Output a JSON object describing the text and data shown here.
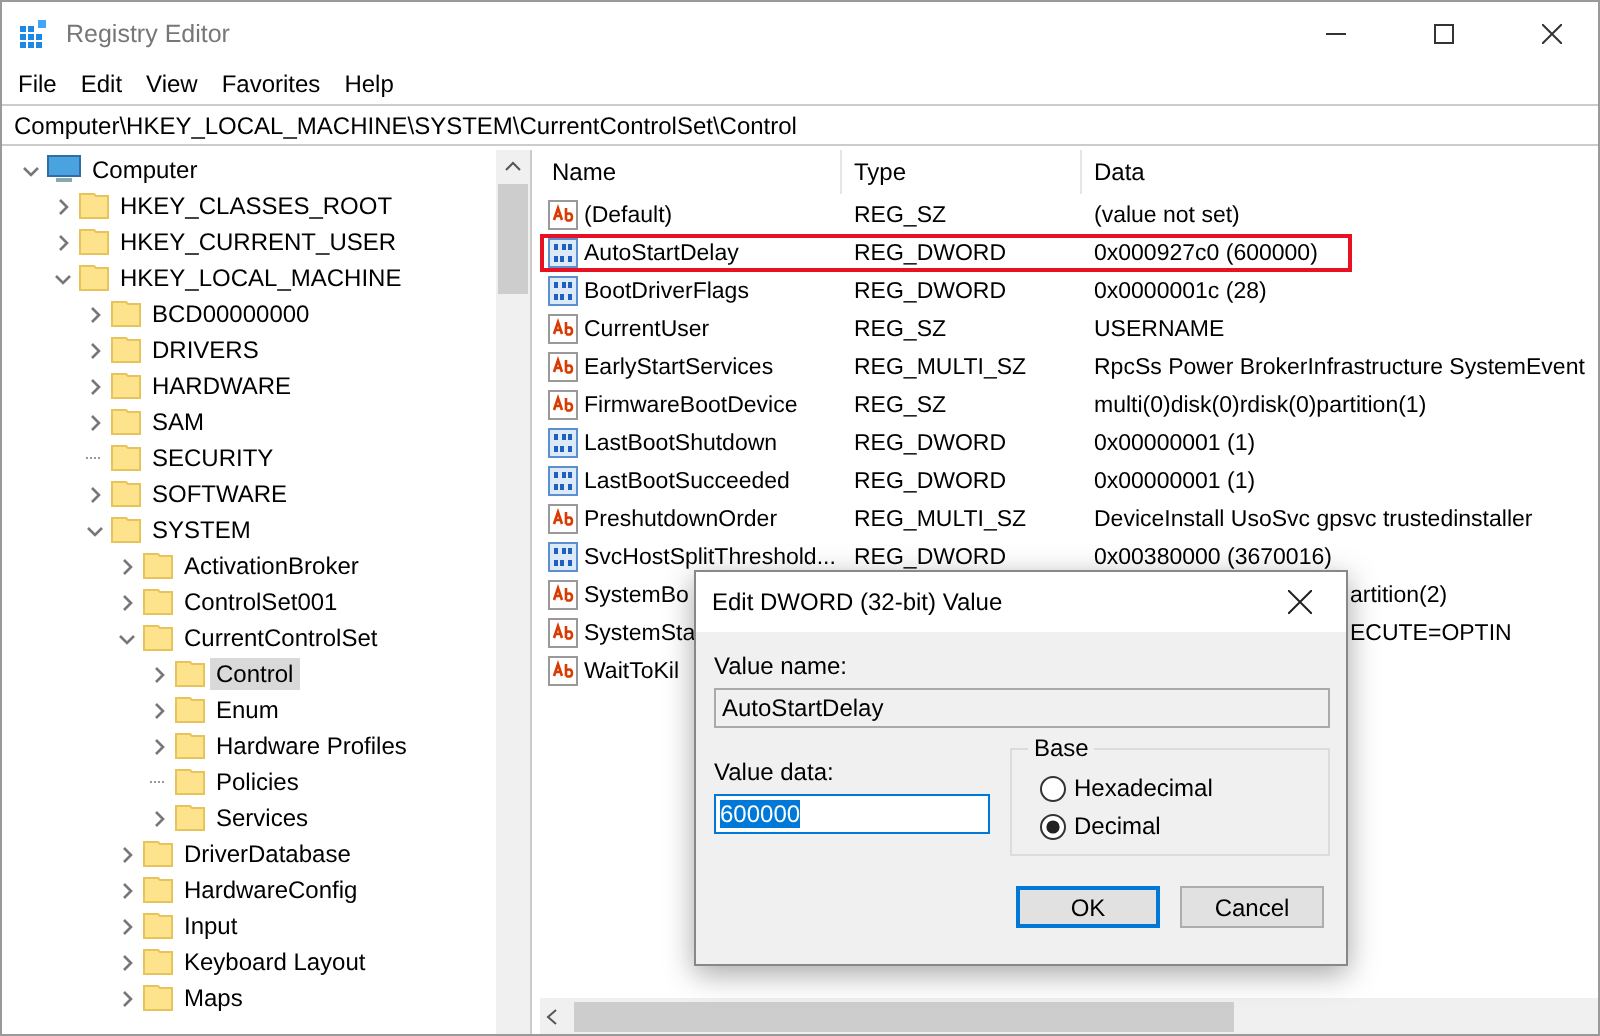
{
  "window": {
    "title": "Registry Editor"
  },
  "menu": [
    "File",
    "Edit",
    "View",
    "Favorites",
    "Help"
  ],
  "address": "Computer\\HKEY_LOCAL_MACHINE\\SYSTEM\\CurrentControlSet\\Control",
  "tree": [
    {
      "label": "Computer",
      "kind": "computer",
      "expanded": true,
      "selected": false,
      "children": [
        {
          "label": "HKEY_CLASSES_ROOT",
          "kind": "branch",
          "expanded": false,
          "selected": false
        },
        {
          "label": "HKEY_CURRENT_USER",
          "kind": "branch",
          "expanded": false,
          "selected": false
        },
        {
          "label": "HKEY_LOCAL_MACHINE",
          "kind": "branch",
          "expanded": true,
          "selected": false,
          "children": [
            {
              "label": "BCD00000000",
              "kind": "branch",
              "expanded": false,
              "selected": false
            },
            {
              "label": "DRIVERS",
              "kind": "branch",
              "expanded": false,
              "selected": false
            },
            {
              "label": "HARDWARE",
              "kind": "branch",
              "expanded": false,
              "selected": false
            },
            {
              "label": "SAM",
              "kind": "branch",
              "expanded": false,
              "selected": false
            },
            {
              "label": "SECURITY",
              "kind": "leaf",
              "expanded": false,
              "selected": false
            },
            {
              "label": "SOFTWARE",
              "kind": "branch",
              "expanded": false,
              "selected": false
            },
            {
              "label": "SYSTEM",
              "kind": "branch",
              "expanded": true,
              "selected": false,
              "children": [
                {
                  "label": "ActivationBroker",
                  "kind": "branch",
                  "expanded": false,
                  "selected": false
                },
                {
                  "label": "ControlSet001",
                  "kind": "branch",
                  "expanded": false,
                  "selected": false
                },
                {
                  "label": "CurrentControlSet",
                  "kind": "branch",
                  "expanded": true,
                  "selected": false,
                  "children": [
                    {
                      "label": "Control",
                      "kind": "branch",
                      "expanded": false,
                      "selected": true
                    },
                    {
                      "label": "Enum",
                      "kind": "branch",
                      "expanded": false,
                      "selected": false
                    },
                    {
                      "label": "Hardware Profiles",
                      "kind": "branch",
                      "expanded": false,
                      "selected": false
                    },
                    {
                      "label": "Policies",
                      "kind": "leaf",
                      "expanded": false,
                      "selected": false
                    },
                    {
                      "label": "Services",
                      "kind": "branch",
                      "expanded": false,
                      "selected": false
                    }
                  ]
                },
                {
                  "label": "DriverDatabase",
                  "kind": "branch",
                  "expanded": false,
                  "selected": false
                },
                {
                  "label": "HardwareConfig",
                  "kind": "branch",
                  "expanded": false,
                  "selected": false
                },
                {
                  "label": "Input",
                  "kind": "branch",
                  "expanded": false,
                  "selected": false
                },
                {
                  "label": "Keyboard Layout",
                  "kind": "branch",
                  "expanded": false,
                  "selected": false
                },
                {
                  "label": "Maps",
                  "kind": "branch",
                  "expanded": false,
                  "selected": false
                }
              ]
            }
          ]
        }
      ]
    }
  ],
  "columns": [
    "Name",
    "Type",
    "Data"
  ],
  "values": [
    {
      "kind": "sz",
      "name": "(Default)",
      "type": "REG_SZ",
      "data": "(value not set)",
      "highlighted": false
    },
    {
      "kind": "dword",
      "name": "AutoStartDelay",
      "type": "REG_DWORD",
      "data": "0x000927c0 (600000)",
      "highlighted": true
    },
    {
      "kind": "dword",
      "name": "BootDriverFlags",
      "type": "REG_DWORD",
      "data": "0x0000001c (28)",
      "highlighted": false
    },
    {
      "kind": "sz",
      "name": "CurrentUser",
      "type": "REG_SZ",
      "data": "USERNAME",
      "highlighted": false
    },
    {
      "kind": "sz",
      "name": "EarlyStartServices",
      "type": "REG_MULTI_SZ",
      "data": "RpcSs Power BrokerInfrastructure SystemEvent",
      "highlighted": false
    },
    {
      "kind": "sz",
      "name": "FirmwareBootDevice",
      "type": "REG_SZ",
      "data": "multi(0)disk(0)rdisk(0)partition(1)",
      "highlighted": false
    },
    {
      "kind": "dword",
      "name": "LastBootShutdown",
      "type": "REG_DWORD",
      "data": "0x00000001 (1)",
      "highlighted": false
    },
    {
      "kind": "dword",
      "name": "LastBootSucceeded",
      "type": "REG_DWORD",
      "data": "0x00000001 (1)",
      "highlighted": false
    },
    {
      "kind": "sz",
      "name": "PreshutdownOrder",
      "type": "REG_MULTI_SZ",
      "data": "DeviceInstall UsoSvc gpsvc trustedinstaller",
      "highlighted": false
    },
    {
      "kind": "dword",
      "name": "SvcHostSplitThreshold...",
      "type": "REG_DWORD",
      "data": "0x00380000 (3670016)",
      "highlighted": false
    },
    {
      "kind": "sz",
      "name": "SystemBo",
      "data_tail": "artition(2)",
      "highlighted": false
    },
    {
      "kind": "sz",
      "name": "SystemSta",
      "data_tail": "ECUTE=OPTIN",
      "highlighted": false
    },
    {
      "kind": "sz",
      "name": "WaitToKil",
      "highlighted": false
    }
  ],
  "dialog": {
    "title": "Edit DWORD (32-bit) Value",
    "name_label": "Value name:",
    "name_value": "AutoStartDelay",
    "data_label": "Value data:",
    "data_value": "600000",
    "base_label": "Base",
    "bases": [
      {
        "label": "Hexadecimal",
        "selected": false
      },
      {
        "label": "Decimal",
        "selected": true
      }
    ],
    "buttons": [
      {
        "label": "OK",
        "default": true
      },
      {
        "label": "Cancel",
        "default": false
      }
    ]
  }
}
